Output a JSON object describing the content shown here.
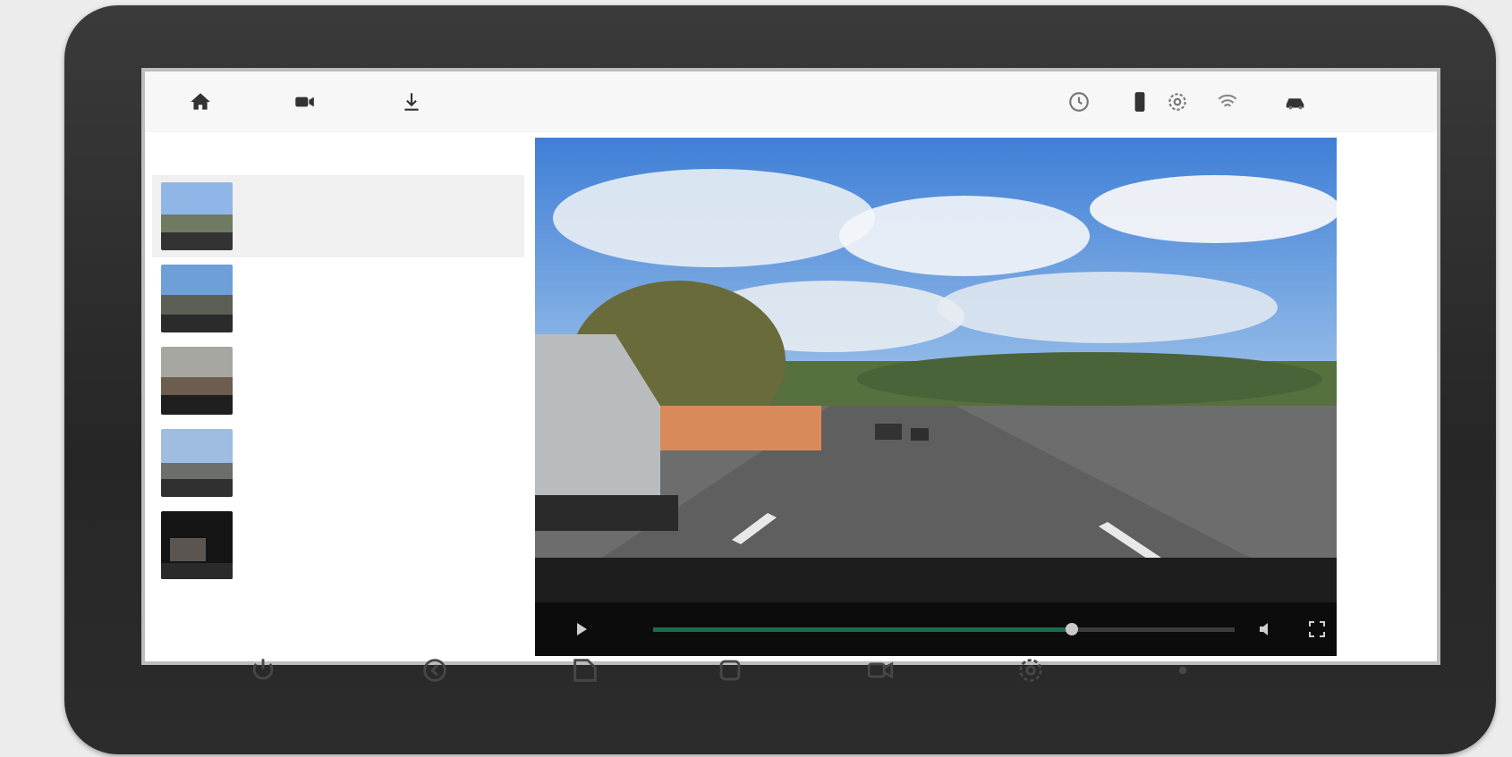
{
  "topbar": {
    "icons": [
      "home-icon",
      "camera-icon",
      "download-icon",
      "clock-icon",
      "phone-icon",
      "gear-icon",
      "wifi-icon",
      "car-icon"
    ],
    "count": ""
  },
  "sidebar": {
    "title": "",
    "items": [
      {
        "time": "",
        "date": "",
        "selected": true
      },
      {
        "time": "",
        "date": "",
        "selected": false
      },
      {
        "time": "",
        "date": "",
        "selected": false
      },
      {
        "time": "",
        "date": "",
        "selected": false
      },
      {
        "time": "",
        "date": "",
        "selected": false
      }
    ]
  },
  "player": {
    "badge": "",
    "osd_text": "",
    "elapsed": "",
    "duration": "",
    "progress": 0.72,
    "icons": [
      "play-icon",
      "volume-icon",
      "fullscreen-icon"
    ]
  },
  "hardware_buttons": [
    "power-icon",
    "back-icon",
    "screenshot-icon",
    "home-icon",
    "video-icon",
    "settings-icon",
    "mic-icon"
  ]
}
